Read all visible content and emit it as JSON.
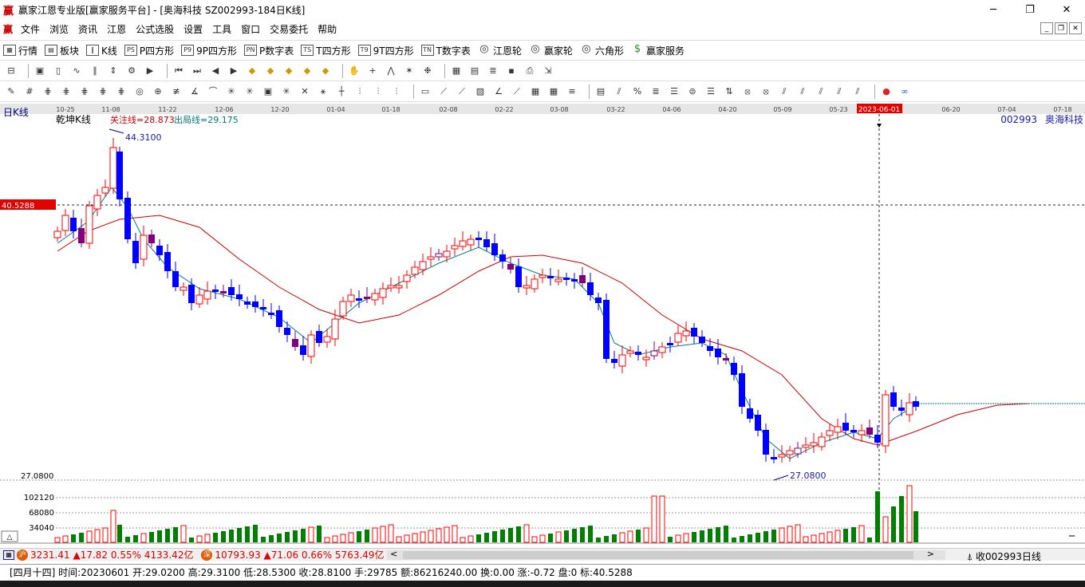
{
  "window": {
    "title": "赢家江恩专业版[赢家服务平台] - [奥海科技  SZ002993-184日K线]",
    "logo": "赢",
    "btn_min": "─",
    "btn_max": "❐",
    "btn_close": "✕"
  },
  "menu": {
    "logo": "赢",
    "items": [
      "文件",
      "浏览",
      "资讯",
      "江恩",
      "公式选股",
      "设置",
      "工具",
      "窗口",
      "交易委托",
      "帮助"
    ]
  },
  "toolbar1": [
    {
      "icon": "▦",
      "label": "行情"
    },
    {
      "icon": "▤",
      "label": "板块"
    },
    {
      "icon": "‖",
      "label": "K线"
    },
    {
      "icon": "PS",
      "label": "P四方形"
    },
    {
      "icon": "P9",
      "label": "9P四方形"
    },
    {
      "icon": "PN",
      "label": "P数字表"
    },
    {
      "icon": "TS",
      "label": "T四方形"
    },
    {
      "icon": "T9",
      "label": "9T四方形"
    },
    {
      "icon": "TN",
      "label": "T数字表"
    },
    {
      "icon": "◎",
      "label": "江恩轮"
    },
    {
      "icon": "◎",
      "label": "赢家轮"
    },
    {
      "icon": "◎",
      "label": "六角形"
    },
    {
      "icon": "$",
      "label": "赢家服务"
    }
  ],
  "chart_header": {
    "period": "日K线",
    "indicator": "乾坤K线",
    "line1": "关注线=28.873",
    "line2": "出局线=29.175",
    "code": "002993",
    "name": "奥海科技"
  },
  "crosshair": {
    "price_label": "40.5288",
    "date_label": "2023-06-01"
  },
  "annotations": {
    "high": "44.3100",
    "low": "27.0800",
    "low_axis": "27.0800"
  },
  "volume_axis": [
    "102120",
    "68080",
    "34040"
  ],
  "dates": [
    {
      "x": 82,
      "t": "10-25"
    },
    {
      "x": 139,
      "t": "11-08"
    },
    {
      "x": 210,
      "t": "11-22"
    },
    {
      "x": 281,
      "t": "12-06"
    },
    {
      "x": 351,
      "t": "12-20"
    },
    {
      "x": 421,
      "t": "01-04"
    },
    {
      "x": 490,
      "t": "01-18"
    },
    {
      "x": 562,
      "t": "02-08"
    },
    {
      "x": 632,
      "t": "02-22"
    },
    {
      "x": 701,
      "t": "03-08"
    },
    {
      "x": 772,
      "t": "03-22"
    },
    {
      "x": 842,
      "t": "04-06"
    },
    {
      "x": 912,
      "t": "04-20"
    },
    {
      "x": 981,
      "t": "05-09"
    },
    {
      "x": 1051,
      "t": "05-23"
    },
    {
      "x": 1192,
      "t": "06-20"
    },
    {
      "x": 1262,
      "t": "07-04"
    },
    {
      "x": 1332,
      "t": "07-18"
    }
  ],
  "index_bar": {
    "sh": "3231.41",
    "sh_change": "▲17.82",
    "sh_pct": "0.55%",
    "sh_amount": "4133.42亿",
    "sz": "10793.93",
    "sz_change": "▲71.06",
    "sz_pct": "0.66%",
    "sz_amount": "5763.49亿",
    "left_arrow": "<",
    "right_arrow": ">",
    "right_label": "收002993日线"
  },
  "status": "[四月十四] 时间:20230601 开:29.0200 高:29.3100 低:28.5300 收:28.8100 手:29785 额:86216240.00 换:0.00 涨:-0.72 盘:0 标:40.5288",
  "colors": {
    "up": "#ff0000",
    "down": "#0000ff",
    "neutral": "#800080",
    "vol_up": "#ff0000",
    "vol_down": "#008000",
    "ma_slow": "#cc0000",
    "ma_fast": "#008080"
  },
  "chart_data": {
    "type": "candlestick",
    "y_range": [
      27.08,
      44.31
    ],
    "marked_high": 44.31,
    "marked_low": 27.08,
    "crosshair_price": 40.5288,
    "selected_bar": {
      "date": "20230601",
      "open": 29.02,
      "high": 29.31,
      "low": 28.53,
      "close": 28.81,
      "volume": 29785
    }
  }
}
